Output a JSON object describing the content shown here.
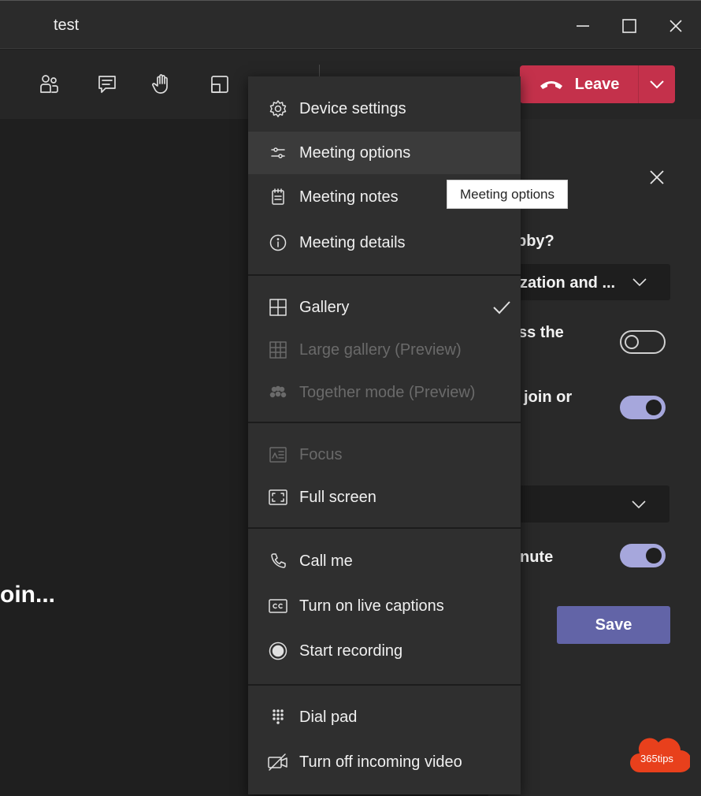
{
  "window": {
    "title": "test",
    "controls": [
      "minimize-icon",
      "maximize-icon",
      "close-icon"
    ]
  },
  "toolbar": {
    "icons": [
      "participants-icon",
      "chat-icon",
      "raise-hand-icon",
      "share-tray-icon"
    ],
    "leave": {
      "label": "Leave",
      "color": "#c4314b"
    }
  },
  "stage": {
    "text": "oin..."
  },
  "panel": {
    "line_lobby": "bby?",
    "select_lobby": "zation and ...",
    "line_bypass": "ss the",
    "line_join": "join or",
    "line_mute": "nute",
    "save_label": "Save",
    "toggles": {
      "bypass": false,
      "join": true,
      "mute": true
    },
    "accent": "#6264a7"
  },
  "menu": {
    "items": [
      {
        "label": "Device settings",
        "icon": "gear-icon"
      },
      {
        "label": "Meeting options",
        "icon": "sliders-icon",
        "highlighted": true
      },
      {
        "label": "Meeting notes",
        "icon": "notes-icon"
      },
      {
        "label": "Meeting details",
        "icon": "info-icon"
      },
      {
        "label": "Gallery",
        "icon": "gallery-icon",
        "checked": true
      },
      {
        "label": "Large gallery (Preview)",
        "icon": "large-gallery-icon",
        "disabled": true
      },
      {
        "label": "Together mode (Preview)",
        "icon": "together-mode-icon",
        "disabled": true
      },
      {
        "label": "Focus",
        "icon": "focus-icon",
        "disabled": true
      },
      {
        "label": "Full screen",
        "icon": "fullscreen-icon"
      },
      {
        "label": "Call me",
        "icon": "phone-icon"
      },
      {
        "label": "Turn on live captions",
        "icon": "captions-icon"
      },
      {
        "label": "Start recording",
        "icon": "record-icon"
      },
      {
        "label": "Dial pad",
        "icon": "dialpad-icon"
      },
      {
        "label": "Turn off incoming video",
        "icon": "video-off-icon"
      }
    ]
  },
  "tooltip": {
    "text": "Meeting options"
  },
  "watermark": {
    "text": "365tips",
    "color": "#e8401c"
  }
}
